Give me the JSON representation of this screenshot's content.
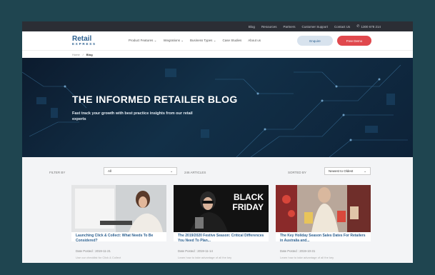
{
  "topbar": {
    "links": [
      "Blog",
      "Resources",
      "Partners",
      "Customer Support",
      "Contact Us"
    ],
    "phone": "1300 678 214"
  },
  "nav": {
    "logo_line1": "Retail",
    "logo_line2": "EXPRESS",
    "items": [
      "Product Features",
      "Integrations",
      "Business Types",
      "Case Studies",
      "About us"
    ],
    "enquire_label": "Enquire",
    "trial_label": "Free Demo"
  },
  "breadcrumb": {
    "home": "Home",
    "sep": "/",
    "current": "Blog"
  },
  "hero": {
    "title": "THE INFORMED RETAILER BLOG",
    "subtitle": "Fast track your growth with best practice insights from our retail experts"
  },
  "filters": {
    "filter_label": "FILTER BY",
    "filter_value": "All",
    "article_count": "246 ARTICLES",
    "sort_label": "SORTED BY",
    "sort_value": "Newest to Oldest"
  },
  "cards": [
    {
      "title": "Launching Click & Collect: What Needs To Be Considered?",
      "date": "Date Posted : 2019-11-21",
      "desc": "Use our checklist for Click & Collect"
    },
    {
      "title": "The 2019/2020 Festive Season: Critical Differences You Need To Plan...",
      "date": "Date Posted : 2019-11-14",
      "desc": "Learn how to take advantage of all the key",
      "overlay_line1": "BLACK",
      "overlay_line2": "FRIDAY"
    },
    {
      "title": "The Key Holiday Season Sales Dates For Retailers in Australia and...",
      "date": "Date Posted : 2019-10-31",
      "desc": "Learn how to take advantage of all the key"
    }
  ],
  "colors": {
    "frame": "#1f4550",
    "brand_blue": "#2b5f8f",
    "trial_red": "#e0484d",
    "topbar": "#2b2e35"
  }
}
